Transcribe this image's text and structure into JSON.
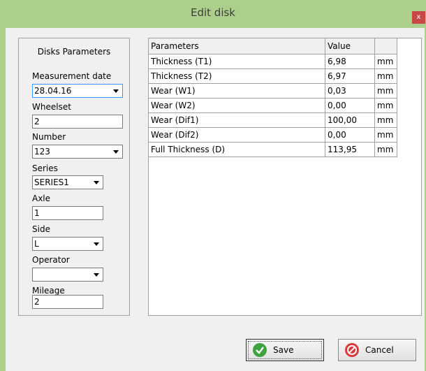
{
  "window": {
    "title": "Edit disk",
    "close_glyph": "x"
  },
  "left_panel": {
    "title": "Disks Parameters",
    "fields": {
      "measurement_date": {
        "label": "Measurement date",
        "value": "28.04.16"
      },
      "wheelset": {
        "label": "Wheelset",
        "value": "2"
      },
      "number": {
        "label": "Number",
        "value": "123"
      },
      "series": {
        "label": "Series",
        "value": "SERIES1"
      },
      "axle": {
        "label": "Axle",
        "value": "1"
      },
      "side": {
        "label": "Side",
        "value": "L"
      },
      "operator": {
        "label": "Operator",
        "value": ""
      },
      "mileage": {
        "label": "Mileage",
        "value": "2"
      }
    }
  },
  "grid": {
    "headers": [
      "Parameters",
      "Value",
      ""
    ],
    "rows": [
      [
        "Thickness (T1)",
        "6,98",
        "mm"
      ],
      [
        "Thickness (T2)",
        "6,97",
        "mm"
      ],
      [
        "Wear (W1)",
        "0,03",
        "mm"
      ],
      [
        "Wear (W2)",
        "0,00",
        "mm"
      ],
      [
        "Wear (Dif1)",
        "100,00",
        "mm"
      ],
      [
        "Wear (Dif2)",
        "0,00",
        "mm"
      ],
      [
        "Full Thickness (D)",
        "113,95",
        "mm"
      ]
    ]
  },
  "buttons": {
    "save": "Save",
    "cancel": "Cancel"
  },
  "icons": {
    "save": "check-icon",
    "cancel": "no-entry-icon"
  },
  "colors": {
    "frame": "#acd08c",
    "close": "#c84848",
    "save_icon": "#3ea33e",
    "cancel_icon": "#d83a3a"
  }
}
